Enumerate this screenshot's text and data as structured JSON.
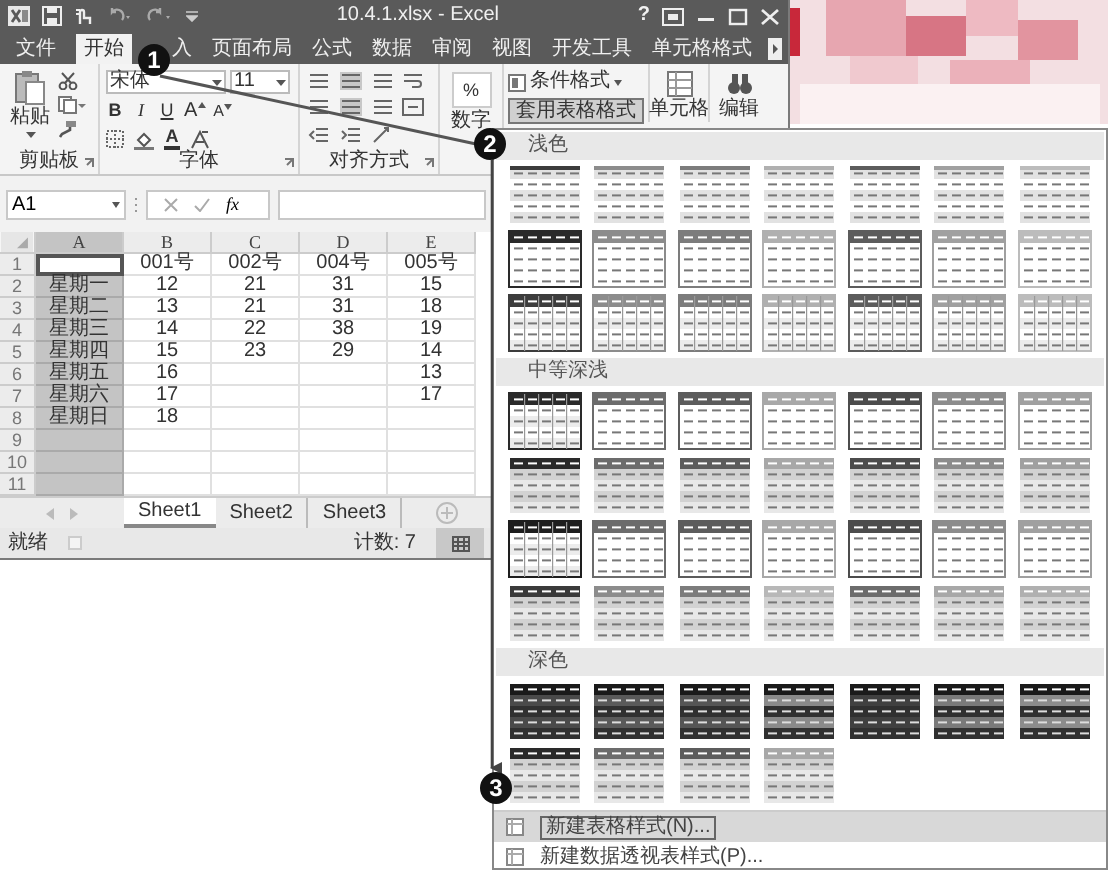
{
  "window": {
    "title": "10.4.1.xlsx - Excel",
    "help": "?"
  },
  "ribbon_tabs": [
    {
      "label": "文件",
      "selected": false
    },
    {
      "label": "开始",
      "selected": true
    },
    {
      "label": "入",
      "selected": false
    },
    {
      "label": "页面布局",
      "selected": false
    },
    {
      "label": "公式",
      "selected": false
    },
    {
      "label": "数据",
      "selected": false
    },
    {
      "label": "审阅",
      "selected": false
    },
    {
      "label": "视图",
      "selected": false
    },
    {
      "label": "开发工具",
      "selected": false
    },
    {
      "label": "单元格格式",
      "selected": false
    }
  ],
  "ribbon": {
    "clipboard": {
      "paste": "粘贴",
      "group": "剪贴板"
    },
    "font": {
      "name": "宋体",
      "size": "11",
      "format_buttons": [
        "B",
        "I",
        "U"
      ],
      "size_buttons": [
        "A",
        "A"
      ],
      "color_button": "A",
      "group": "字体"
    },
    "alignment": {
      "group": "对齐方式"
    },
    "number": {
      "button": "%",
      "label": "数字"
    },
    "styles": {
      "conditional": "条件格式",
      "table_format": "套用表格格式",
      "cells": "单元格",
      "editing": "编辑"
    }
  },
  "formula_bar": {
    "name_box": "A1",
    "function_label": "fx"
  },
  "sheet": {
    "columns": [
      {
        "label": "A",
        "selected": true
      },
      {
        "label": "B",
        "selected": false
      },
      {
        "label": "C",
        "selected": false
      },
      {
        "label": "D",
        "selected": false
      },
      {
        "label": "E",
        "selected": false
      }
    ],
    "rows": [
      {
        "number": "1",
        "cells": [
          null,
          "001号",
          "002号",
          "004号",
          "005号"
        ]
      },
      {
        "number": "2",
        "cells": [
          "星期一",
          "12",
          "21",
          "31",
          "15"
        ]
      },
      {
        "number": "3",
        "cells": [
          "星期二",
          "13",
          "21",
          "31",
          "18"
        ]
      },
      {
        "number": "4",
        "cells": [
          "星期三",
          "14",
          "22",
          "38",
          "19"
        ]
      },
      {
        "number": "5",
        "cells": [
          "星期四",
          "15",
          "23",
          "29",
          "14"
        ]
      },
      {
        "number": "6",
        "cells": [
          "星期五",
          "16",
          null,
          null,
          "13"
        ]
      },
      {
        "number": "7",
        "cells": [
          "星期六",
          "17",
          null,
          null,
          "17"
        ]
      },
      {
        "number": "8",
        "cells": [
          "星期日",
          "18",
          null,
          null,
          null
        ]
      },
      {
        "number": "9",
        "cells": [
          null,
          null,
          null,
          null,
          null
        ]
      },
      {
        "number": "10",
        "cells": [
          null,
          null,
          null,
          null,
          null
        ]
      },
      {
        "number": "11",
        "cells": [
          null,
          null,
          null,
          null,
          null
        ]
      }
    ]
  },
  "sheet_tabs": [
    {
      "label": "Sheet1",
      "selected": true
    },
    {
      "label": "Sheet2",
      "selected": false
    },
    {
      "label": "Sheet3",
      "selected": false
    }
  ],
  "status_bar": {
    "ready": "就绪",
    "count": "计数: 7"
  },
  "gallery": {
    "sections": [
      {
        "title": "浅色",
        "styles": [
          {
            "kind": "banded",
            "color": "#3c3c3c"
          },
          {
            "kind": "banded",
            "color": "#8c8c8c"
          },
          {
            "kind": "banded",
            "color": "#7c7c7c"
          },
          {
            "kind": "banded",
            "color": "#b0b0b0"
          },
          {
            "kind": "banded",
            "color": "#5c5c5c"
          },
          {
            "kind": "banded",
            "color": "#a0a0a0"
          },
          {
            "kind": "banded",
            "color": "#bcbcbc"
          },
          {
            "kind": "header",
            "color": "#2a2a2a"
          },
          {
            "kind": "header",
            "color": "#8c8c8c"
          },
          {
            "kind": "header",
            "color": "#7c7c7c"
          },
          {
            "kind": "header",
            "color": "#b0b0b0"
          },
          {
            "kind": "header",
            "color": "#5c5c5c"
          },
          {
            "kind": "header",
            "color": "#a0a0a0"
          },
          {
            "kind": "header",
            "color": "#bcbcbc"
          },
          {
            "kind": "grid",
            "color": "#3c3c3c"
          },
          {
            "kind": "grid",
            "color": "#8c8c8c"
          },
          {
            "kind": "grid",
            "color": "#7c7c7c"
          },
          {
            "kind": "grid",
            "color": "#b0b0b0"
          },
          {
            "kind": "grid",
            "color": "#5c5c5c"
          },
          {
            "kind": "grid",
            "color": "#a0a0a0"
          },
          {
            "kind": "grid",
            "color": "#bcbcbc"
          }
        ]
      },
      {
        "title": "中等深浅",
        "styles": [
          {
            "kind": "grid",
            "color": "#2a2a2a"
          },
          {
            "kind": "header",
            "color": "#6c6c6c"
          },
          {
            "kind": "header",
            "color": "#5c5c5c"
          },
          {
            "kind": "header",
            "color": "#a8a8a8"
          },
          {
            "kind": "header",
            "color": "#4c4c4c"
          },
          {
            "kind": "header",
            "color": "#8c8c8c"
          },
          {
            "kind": "header",
            "color": "#a0a0a0"
          },
          {
            "kind": "filled",
            "color": "#2a2a2a"
          },
          {
            "kind": "filled",
            "color": "#6c6c6c"
          },
          {
            "kind": "filled",
            "color": "#5c5c5c"
          },
          {
            "kind": "filled",
            "color": "#a8a8a8"
          },
          {
            "kind": "filled",
            "color": "#4c4c4c"
          },
          {
            "kind": "filled",
            "color": "#8c8c8c"
          },
          {
            "kind": "filled",
            "color": "#a0a0a0"
          },
          {
            "kind": "grid",
            "color": "#1e1e1e"
          },
          {
            "kind": "header",
            "color": "#6c6c6c"
          },
          {
            "kind": "header",
            "color": "#5c5c5c"
          },
          {
            "kind": "header",
            "color": "#a8a8a8"
          },
          {
            "kind": "header",
            "color": "#4c4c4c"
          },
          {
            "kind": "header",
            "color": "#8c8c8c"
          },
          {
            "kind": "header",
            "color": "#a0a0a0"
          },
          {
            "kind": "filled",
            "color": "#3a3a3a"
          },
          {
            "kind": "filled",
            "color": "#8c8c8c"
          },
          {
            "kind": "filled",
            "color": "#7c7c7c"
          },
          {
            "kind": "filled",
            "color": "#b8b8b8"
          },
          {
            "kind": "filled",
            "color": "#6c6c6c"
          },
          {
            "kind": "filled",
            "color": "#a8a8a8"
          },
          {
            "kind": "filled",
            "color": "#b0b0b0"
          }
        ]
      },
      {
        "title": "深色",
        "styles": [
          {
            "kind": "dark",
            "color": "#4a4a4a"
          },
          {
            "kind": "dark",
            "color": "#5a5a5a"
          },
          {
            "kind": "dark",
            "color": "#555555"
          },
          {
            "kind": "dark",
            "color": "#8a8a8a"
          },
          {
            "kind": "dark",
            "color": "#404040"
          },
          {
            "kind": "dark",
            "color": "#7a7a7a"
          },
          {
            "kind": "dark",
            "color": "#8c8c8c"
          },
          {
            "kind": "filled",
            "color": "#2a2a2a"
          },
          {
            "kind": "filled",
            "color": "#6c6c6c"
          },
          {
            "kind": "filled",
            "color": "#5c5c5c"
          },
          {
            "kind": "filled",
            "color": "#a8a8a8"
          }
        ]
      }
    ],
    "menu": [
      {
        "label": "新建表格样式(N)...",
        "selected": true
      },
      {
        "label": "新建数据透视表样式(P)...",
        "selected": false
      }
    ]
  },
  "callouts": [
    "1",
    "2",
    "3"
  ]
}
